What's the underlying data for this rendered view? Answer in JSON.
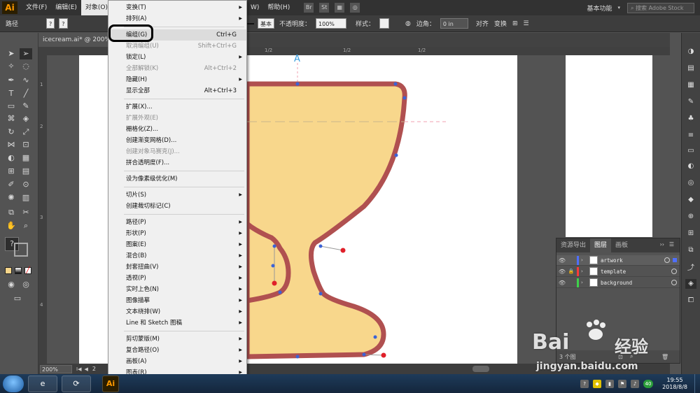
{
  "app": {
    "logo": "Ai"
  },
  "menubar": {
    "items": [
      "文件(F)",
      "编辑(E)",
      "对象(O)"
    ],
    "active_index": 2,
    "mid_item": "W)",
    "help": "帮助(H)",
    "bridge_label": "Br",
    "stock_label": "St",
    "workspace": "基本功能",
    "search_placeholder": "搜索 Adobe Stock"
  },
  "controlbar": {
    "path_label": "路径",
    "stroke_style": "基本",
    "opacity_label": "不透明度：",
    "opacity_value": "100%",
    "style_label": "样式：",
    "corner_label": "边角：",
    "corner_value": "0 in",
    "align_label": "对齐",
    "transform_label": "变换"
  },
  "document": {
    "tab_title": "icecream.ai* @ 200%",
    "zoom": "200%",
    "page_number": "2",
    "anchor_label": "A"
  },
  "dropdown": {
    "items": [
      {
        "label": "变换(T)",
        "shortcut": "",
        "submenu": true,
        "disabled": false
      },
      {
        "label": "排列(A)",
        "shortcut": "",
        "submenu": true,
        "disabled": false
      },
      {
        "sep": true
      },
      {
        "label": "编组(G)",
        "shortcut": "Ctrl+G",
        "submenu": false,
        "disabled": false,
        "hover": true
      },
      {
        "label": "取消编组(U)",
        "shortcut": "Shift+Ctrl+G",
        "submenu": false,
        "disabled": true
      },
      {
        "label": "锁定(L)",
        "shortcut": "",
        "submenu": true,
        "disabled": false
      },
      {
        "label": "全部解锁(K)",
        "shortcut": "Alt+Ctrl+2",
        "submenu": false,
        "disabled": true
      },
      {
        "label": "隐藏(H)",
        "shortcut": "",
        "submenu": true,
        "disabled": false
      },
      {
        "label": "显示全部",
        "shortcut": "Alt+Ctrl+3",
        "submenu": false,
        "disabled": false
      },
      {
        "sep": true
      },
      {
        "label": "扩展(X)...",
        "shortcut": "",
        "submenu": false,
        "disabled": false
      },
      {
        "label": "扩展外观(E)",
        "shortcut": "",
        "submenu": false,
        "disabled": true
      },
      {
        "label": "栅格化(Z)...",
        "shortcut": "",
        "submenu": false,
        "disabled": false
      },
      {
        "label": "创建渐变网格(D)...",
        "shortcut": "",
        "submenu": false,
        "disabled": false
      },
      {
        "label": "创建对象马赛克(J)...",
        "shortcut": "",
        "submenu": false,
        "disabled": true
      },
      {
        "label": "拼合透明度(F)...",
        "shortcut": "",
        "submenu": false,
        "disabled": false
      },
      {
        "sep": true
      },
      {
        "label": "设为像素级优化(M)",
        "shortcut": "",
        "submenu": false,
        "disabled": false
      },
      {
        "sep": true
      },
      {
        "label": "切片(S)",
        "shortcut": "",
        "submenu": true,
        "disabled": false
      },
      {
        "label": "创建裁切标记(C)",
        "shortcut": "",
        "submenu": false,
        "disabled": false
      },
      {
        "sep": true
      },
      {
        "label": "路径(P)",
        "shortcut": "",
        "submenu": true,
        "disabled": false
      },
      {
        "label": "形状(P)",
        "shortcut": "",
        "submenu": true,
        "disabled": false
      },
      {
        "label": "图案(E)",
        "shortcut": "",
        "submenu": true,
        "disabled": false
      },
      {
        "label": "混合(B)",
        "shortcut": "",
        "submenu": true,
        "disabled": false
      },
      {
        "label": "封套扭曲(V)",
        "shortcut": "",
        "submenu": true,
        "disabled": false
      },
      {
        "label": "透视(P)",
        "shortcut": "",
        "submenu": true,
        "disabled": false
      },
      {
        "label": "实时上色(N)",
        "shortcut": "",
        "submenu": true,
        "disabled": false
      },
      {
        "label": "图像描摹",
        "shortcut": "",
        "submenu": true,
        "disabled": false
      },
      {
        "label": "文本绕排(W)",
        "shortcut": "",
        "submenu": true,
        "disabled": false
      },
      {
        "label": "Line 和 Sketch 图稿",
        "shortcut": "",
        "submenu": true,
        "disabled": false
      },
      {
        "sep": true
      },
      {
        "label": "剪切蒙版(M)",
        "shortcut": "",
        "submenu": true,
        "disabled": false
      },
      {
        "label": "复合路径(O)",
        "shortcut": "",
        "submenu": true,
        "disabled": false
      },
      {
        "label": "画板(A)",
        "shortcut": "",
        "submenu": true,
        "disabled": false
      },
      {
        "label": "图表(R)",
        "shortcut": "",
        "submenu": true,
        "disabled": false
      }
    ]
  },
  "layers_panel": {
    "tabs": [
      "资源导出",
      "图层",
      "画板"
    ],
    "active_tab": 1,
    "layers": [
      {
        "name": "artwork",
        "color": "#4f6fff",
        "locked": false,
        "selected": true
      },
      {
        "name": "template",
        "color": "#ff3a3a",
        "locked": true,
        "selected": false
      },
      {
        "name": "background",
        "color": "#3ed24a",
        "locked": false,
        "selected": false
      }
    ],
    "footer_count": "3 个图"
  },
  "colors": {
    "cup_fill": "#f8d78c",
    "cup_stroke": "#b05050",
    "anchor": "#3b63d6",
    "handle": "#e0202a"
  },
  "taskbar": {
    "time": "19:55",
    "date": "2018/8/8",
    "ai_label": "Ai",
    "badge": "40"
  },
  "watermark": {
    "brand": "Bai",
    "brand2": "经验",
    "url": "jingyan.baidu.com"
  }
}
